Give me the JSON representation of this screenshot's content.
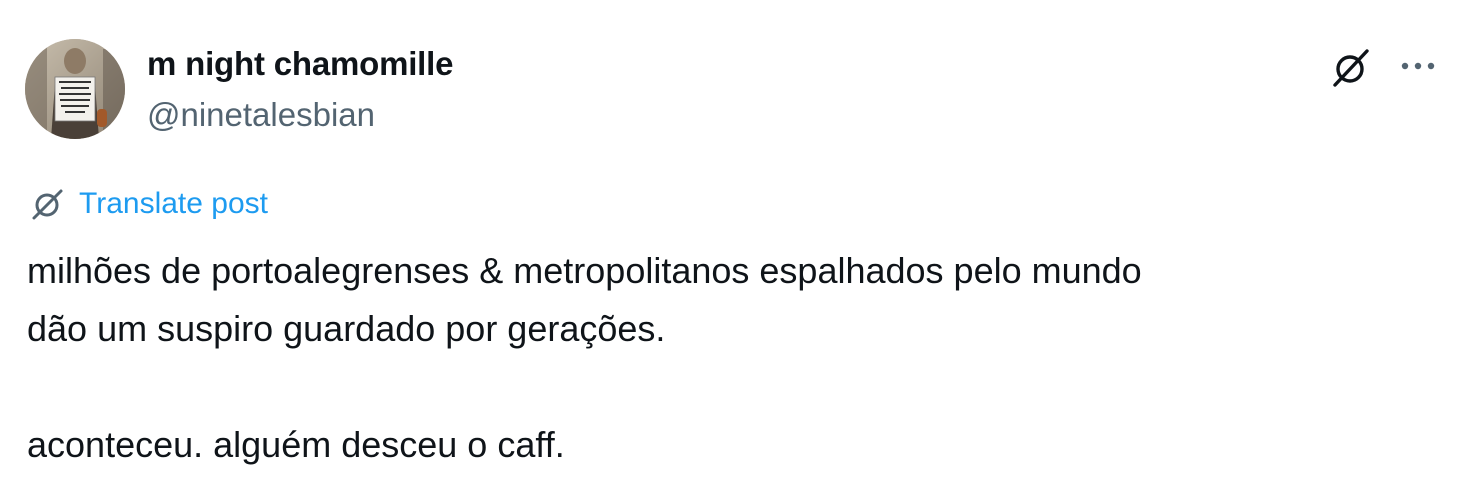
{
  "post": {
    "author": {
      "display_name": "m night chamomille",
      "handle": "@ninetalesbian",
      "avatar_sign_text": "I CAN'T BELIEVE I STILL HAVE TO PROTEST THIS FUCKING SHIT"
    },
    "translate_label": "Translate post",
    "text_lines": [
      "milhões de portoalegrenses & metropolitanos espalhados pelo mundo",
      "dão um suspiro guardado por gerações.",
      "",
      "aconteceu. alguém desceu o caff."
    ]
  },
  "icons": {
    "grok": "grok-icon",
    "more": "more-dots-icon",
    "translate": "translate-icon"
  },
  "colors": {
    "text_primary": "#0f1419",
    "text_secondary": "#536471",
    "link_blue": "#1d9bf0"
  }
}
